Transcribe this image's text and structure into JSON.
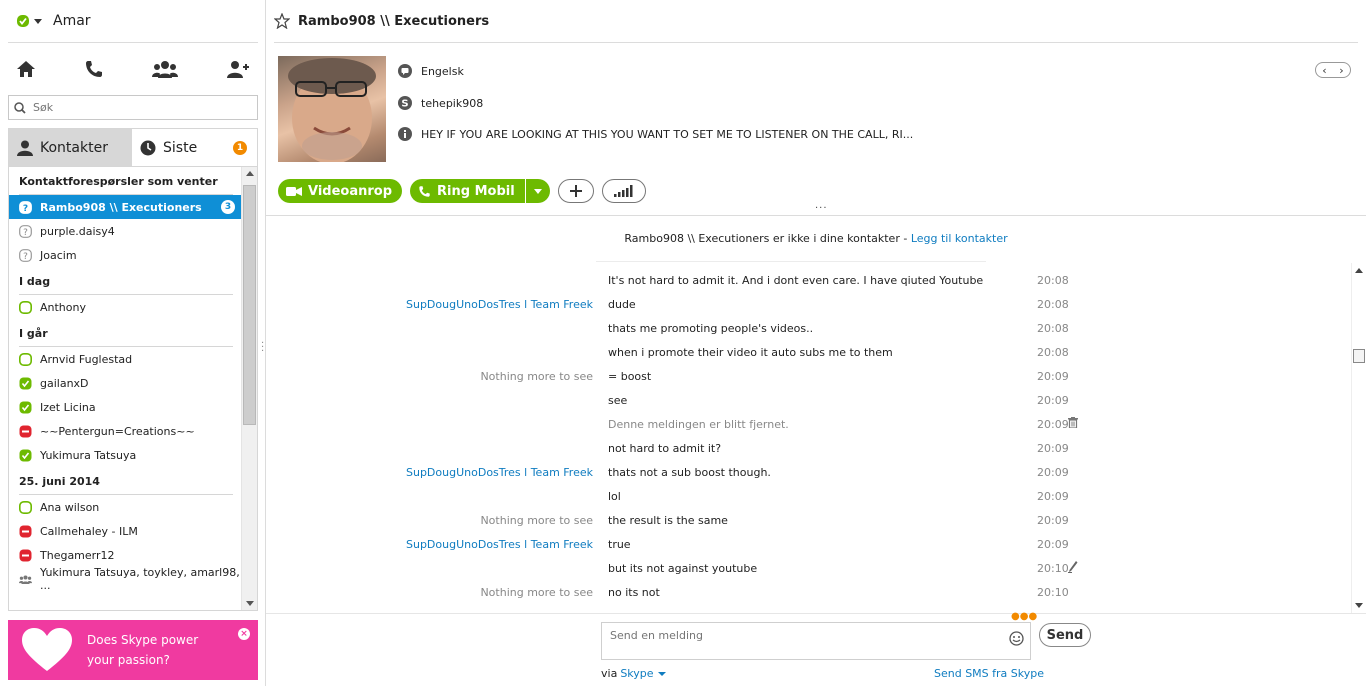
{
  "profile": {
    "name": "Amar"
  },
  "search": {
    "placeholder": "Søk"
  },
  "tabs": {
    "contacts": "Kontakter",
    "recent": "Siste",
    "recent_badge": "1"
  },
  "contact_list": {
    "groups": [
      {
        "header": "Kontaktforespørsler som venter",
        "items": [
          {
            "name": "Rambo908 \\\\ Executioners",
            "status": "pending",
            "badge": "3",
            "selected": true
          },
          {
            "name": "purple.daisy4",
            "status": "pending"
          },
          {
            "name": "Joacim",
            "status": "pending"
          }
        ]
      },
      {
        "header": "I dag",
        "items": [
          {
            "name": "Anthony",
            "status": "offline-green"
          }
        ]
      },
      {
        "header": "I går",
        "items": [
          {
            "name": "Arnvid Fuglestad",
            "status": "offline-green"
          },
          {
            "name": "gailanxD",
            "status": "online"
          },
          {
            "name": "Izet  Licina",
            "status": "online"
          },
          {
            "name": "~~Pentergun=Creations~~",
            "status": "busy"
          },
          {
            "name": "Yukimura Tatsuya",
            "status": "online"
          }
        ]
      },
      {
        "header": "25. juni 2014",
        "items": [
          {
            "name": "Ana wilson",
            "status": "offline-green"
          },
          {
            "name": "Callmehaley - ILM",
            "status": "busy"
          },
          {
            "name": "Thegamerr12",
            "status": "busy"
          },
          {
            "name": "Yukimura Tatsuya, toykley, amarl98, ...",
            "status": "group"
          }
        ]
      }
    ]
  },
  "ad": {
    "text": "Does Skype power your passion?",
    "close": "×"
  },
  "conversation": {
    "title": "Rambo908 \\\\ Executioners",
    "language": "Engelsk",
    "skype_name": "tehepik908",
    "mood": "HEY IF YOU ARE LOOKING AT THIS YOU WANT TO SET ME TO LISTENER ON THE CALL, RI...",
    "video_button": "Videoanrop",
    "call_button": "Ring Mobil",
    "notice_text": "Rambo908 \\\\ Executioners er ikke i dine kontakter - ",
    "notice_link": "Legg til kontakter"
  },
  "messages": [
    {
      "sender": "",
      "text": "It's not hard to admit it. And i dont even care. I have qiuted Youtube",
      "time": "20:08"
    },
    {
      "sender": "SupDougUnoDosTres l Team Freek",
      "sender_style": "link",
      "text": "dude",
      "time": "20:08"
    },
    {
      "sender": "",
      "text": "thats me promoting people's videos..",
      "time": "20:08"
    },
    {
      "sender": "",
      "text": "when i promote their video it auto subs me to them",
      "time": "20:08"
    },
    {
      "sender": "Nothing more to see",
      "sender_style": "gray",
      "text": "= boost",
      "time": "20:09"
    },
    {
      "sender": "",
      "text": "see",
      "time": "20:09"
    },
    {
      "sender": "",
      "text": "Denne meldingen er blitt fjernet.",
      "removed": true,
      "time": "20:09",
      "icon": "trash"
    },
    {
      "sender": "",
      "text": "not hard to admit it?",
      "time": "20:09"
    },
    {
      "sender": "SupDougUnoDosTres l Team Freek",
      "sender_style": "link",
      "text": "thats not a sub boost though.",
      "time": "20:09"
    },
    {
      "sender": "",
      "text": "lol",
      "time": "20:09"
    },
    {
      "sender": "Nothing more to see",
      "sender_style": "gray",
      "text": "the result is the same",
      "time": "20:09"
    },
    {
      "sender": "SupDougUnoDosTres l Team Freek",
      "sender_style": "link",
      "text": "true",
      "time": "20:09"
    },
    {
      "sender": "",
      "text": "but its not against youtube",
      "time": "20:10",
      "icon": "edit"
    },
    {
      "sender": "Nothing more to see",
      "sender_style": "gray",
      "text": "no its not",
      "time": "20:10"
    }
  ],
  "composer": {
    "placeholder": "Send en melding",
    "send": "Send",
    "via_label": "via",
    "via_link": "Skype",
    "sms_link": "Send SMS fra Skype"
  },
  "colors": {
    "skype_green": "#6dba00",
    "selected_blue": "#0f8fd6",
    "link_blue": "#0f7cc0",
    "badge_orange": "#f28a00",
    "ad_pink": "#f03aa0"
  },
  "icons": [
    "status-online-icon",
    "home-icon",
    "phone-icon",
    "contacts-icon",
    "add-contact-icon",
    "search-icon",
    "person-icon",
    "clock-icon",
    "star-icon",
    "language-icon",
    "skype-icon",
    "info-icon",
    "video-icon",
    "plus-icon",
    "signal-icon",
    "emoji-icon",
    "trash-icon",
    "edit-icon",
    "heart-icon"
  ]
}
